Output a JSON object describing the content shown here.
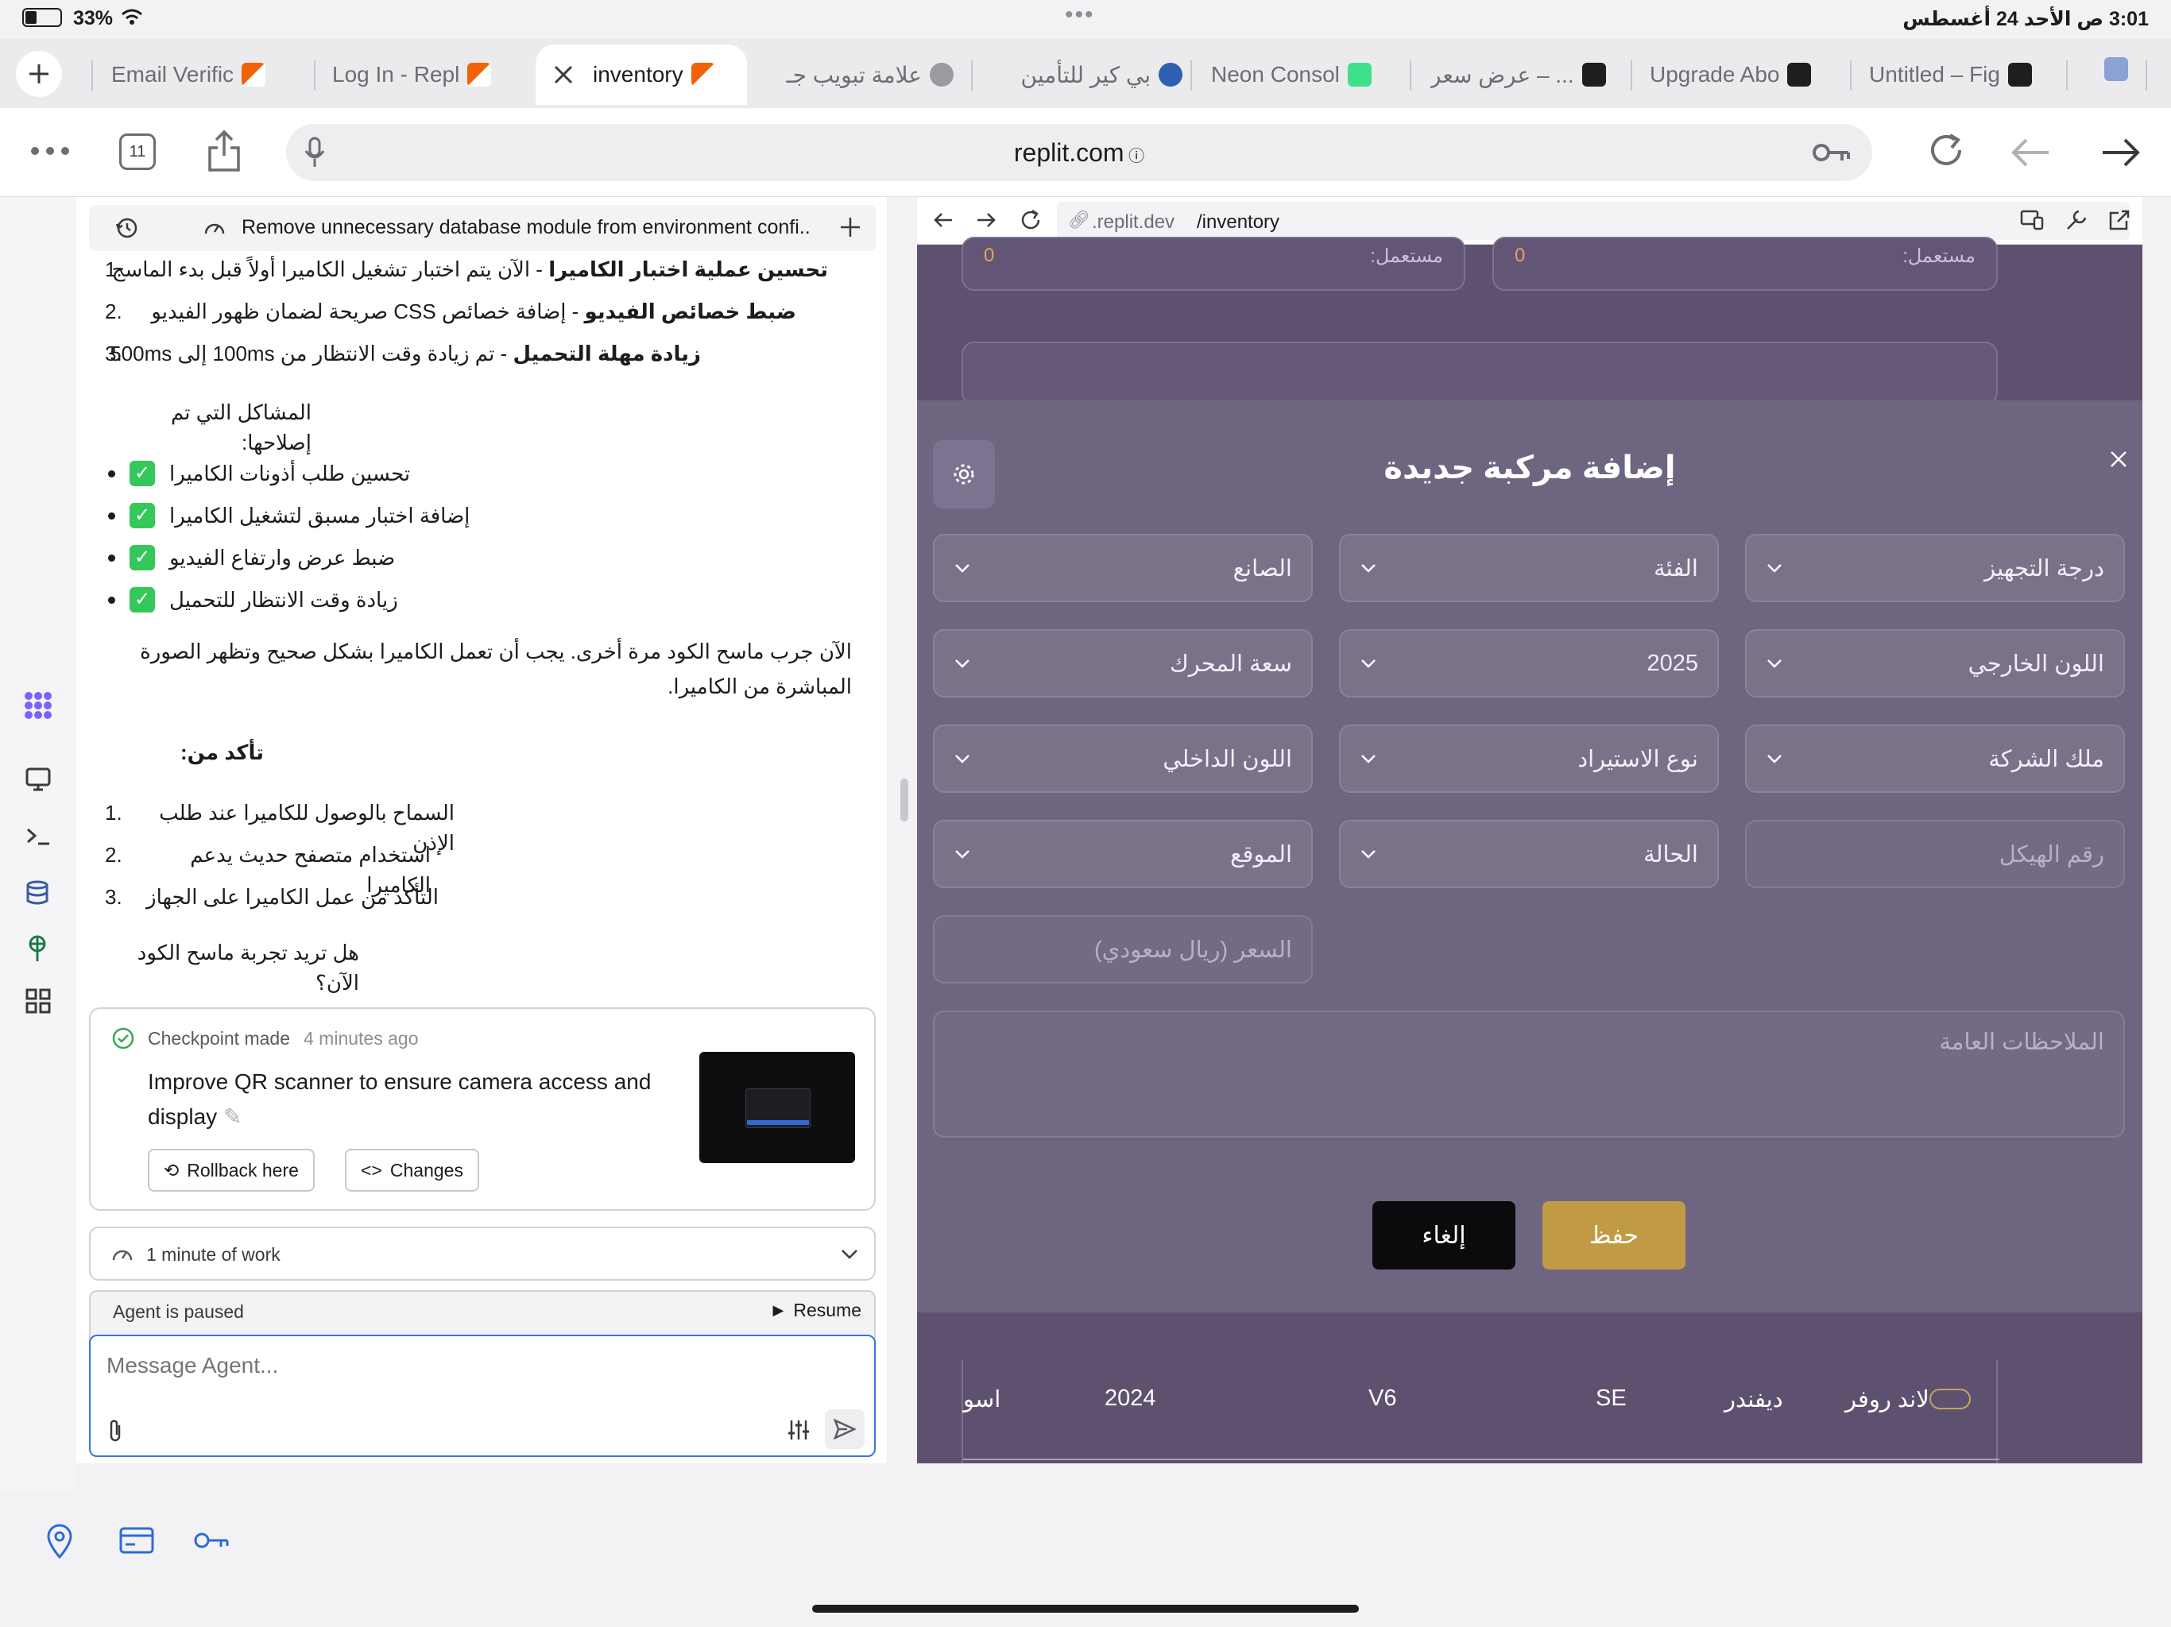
{
  "status": {
    "battery": "33%",
    "dots": "•••",
    "time_date": "3:01 ص  الأحد 24 أغسطس"
  },
  "tabs": [
    {
      "label": "Email Verific"
    },
    {
      "label": "Log In - Repl"
    },
    {
      "label": "inventory"
    },
    {
      "label": "علامة تبويب جـ"
    },
    {
      "label": "بي كير للتأمين"
    },
    {
      "label": "Neon Consol"
    },
    {
      "label": "عرض سعر – ..."
    },
    {
      "label": "Upgrade Abo"
    },
    {
      "label": "Untitled – Fig"
    }
  ],
  "address": {
    "tab_count": "11",
    "url": "replit.com"
  },
  "chat": {
    "header_title": "Remove unnecessary database module from environment confi..",
    "list1": [
      {
        "num": "1.",
        "bold": "تحسين عملية اختبار الكاميرا",
        "rest": " - الآن يتم اختبار تشغيل الكاميرا أولاً قبل بدء الماسح"
      },
      {
        "num": "2.",
        "bold": "ضبط خصائص الفيديو",
        "rest": " - إضافة خصائص CSS صريحة لضمان ظهور الفيديو"
      },
      {
        "num": "3.",
        "bold": "زيادة مهلة التحميل",
        "rest": " - تم زيادة وقت الانتظار من 100ms إلى 500ms"
      }
    ],
    "fixed_heading": "المشاكل التي تم إصلاحها:",
    "bullets": [
      "تحسين طلب أذونات الكاميرا",
      "إضافة اختبار مسبق لتشغيل الكاميرا",
      "ضبط عرض وارتفاع الفيديو",
      "زيادة وقت الانتظار للتحميل"
    ],
    "para": "الآن جرب ماسح الكود مرة أخرى. يجب أن تعمل الكاميرا بشكل صحيح وتظهر الصورة المباشرة من الكاميرا.",
    "confirm_heading": "تأكد من:",
    "list2": [
      {
        "num": "1.",
        "text": "السماح بالوصول للكاميرا عند طلب الإذن"
      },
      {
        "num": "2.",
        "text": "استخدام متصفح حديث يدعم الكاميرا"
      },
      {
        "num": "3.",
        "text": "التأكد من عمل الكاميرا على الجهاز"
      }
    ],
    "question": "هل تريد تجربة ماسح الكود الآن؟",
    "checkpoint": {
      "made": "Checkpoint made",
      "ago": "4 minutes ago",
      "title": "Improve QR scanner to ensure camera access and display",
      "rollback": "Rollback here",
      "changes": "Changes"
    },
    "work": "1 minute of work",
    "paused": "Agent is paused",
    "resume": "Resume",
    "input_placeholder": "Message Agent..."
  },
  "preview": {
    "url_host": ".replit.dev",
    "url_path": "/inventory",
    "card_label": "مستعمل:",
    "card_value": "0",
    "modal_title": "إضافة مركبة جديدة",
    "fields": {
      "grade": "درجة التجهيز",
      "category": "الفئة",
      "maker": "الصانع",
      "ext_color": "اللون الخارجي",
      "year": "2025",
      "engine": "سعة المحرك",
      "owner": "ملك الشركة",
      "import_type": "نوع الاستيراد",
      "int_color": "اللون الداخلي",
      "chassis": "رقم الهيكل",
      "status": "الحالة",
      "location": "الموقع",
      "price": "السعر (ريال سعودي)",
      "notes": "الملاحظات العامة"
    },
    "save": "حفظ",
    "cancel": "إلغاء",
    "row": {
      "brand": "لاند روفر",
      "model": "ديفندر",
      "trim": "SE",
      "engine": "V6",
      "year": "2024",
      "color": "اسو"
    },
    "colors": {
      "gold": "#c09a45",
      "modal": "#6e6580"
    }
  }
}
